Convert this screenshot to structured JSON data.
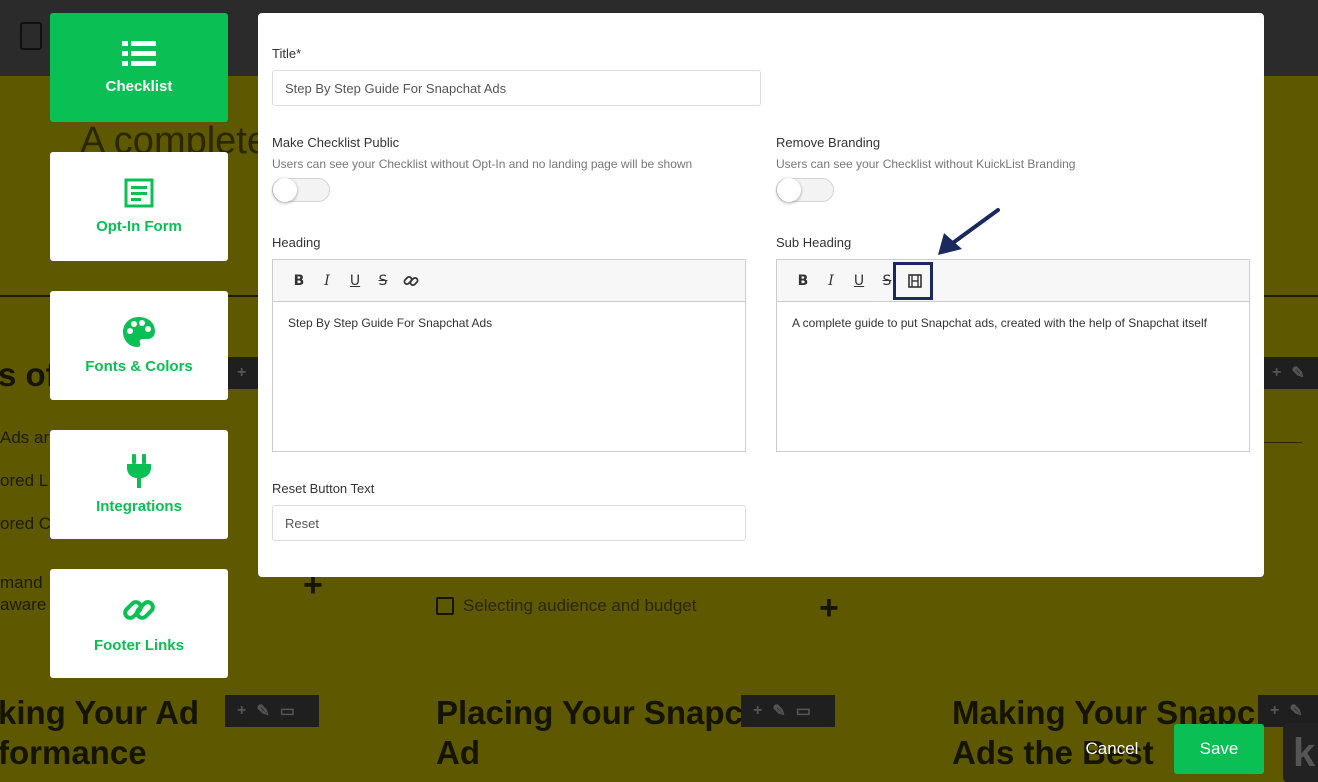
{
  "sidebar": {
    "items": [
      {
        "label": "Checklist",
        "icon": "list-icon",
        "active": true
      },
      {
        "label": "Opt-In Form",
        "icon": "form-icon",
        "active": false
      },
      {
        "label": "Fonts & Colors",
        "icon": "palette-icon",
        "active": false
      },
      {
        "label": "Integrations",
        "icon": "plug-icon",
        "active": false
      },
      {
        "label": "Footer Links",
        "icon": "link-icon",
        "active": false
      }
    ]
  },
  "modal": {
    "title": {
      "label": "Title*",
      "value": "Step By Step Guide For Snapchat Ads"
    },
    "public": {
      "label": "Make Checklist Public",
      "help": "Users can see your Checklist without Opt-In and no landing page will be shown",
      "on": false
    },
    "branding": {
      "label": "Remove Branding",
      "help": "Users can see your Checklist without KuickList Branding",
      "on": false
    },
    "heading": {
      "label": "Heading",
      "content": "Step By Step Guide For Snapchat Ads"
    },
    "subheading": {
      "label": "Sub Heading",
      "content": "A complete guide to put Snapchat ads, created with the help of Snapchat itself"
    },
    "reset": {
      "label": "Reset Button Text",
      "value": "Reset"
    },
    "toolbar": {
      "bold": "B",
      "italic": "I",
      "underline": "U",
      "strike": "S"
    }
  },
  "actions": {
    "cancel": "Cancel",
    "save": "Save"
  },
  "background": {
    "hero_text": "A complete",
    "section_heading_fragment": "s of",
    "list_fragments": [
      "Ads ar",
      "ored L",
      "ored C",
      "mand",
      "aware"
    ],
    "checklist_item": "Selecting audience and budget",
    "card_titles": [
      {
        "line1": "king Your Ad",
        "line2": "formance"
      },
      {
        "line1": "Placing Your Snapc",
        "line2": "Ad"
      },
      {
        "line1": "Making Your Snapc",
        "line2": "Ads the Best"
      }
    ],
    "corner_letter": "k"
  },
  "colors": {
    "accent": "#0abf53",
    "highlight": "#1b2a5e",
    "overlay": "#5e5800"
  }
}
